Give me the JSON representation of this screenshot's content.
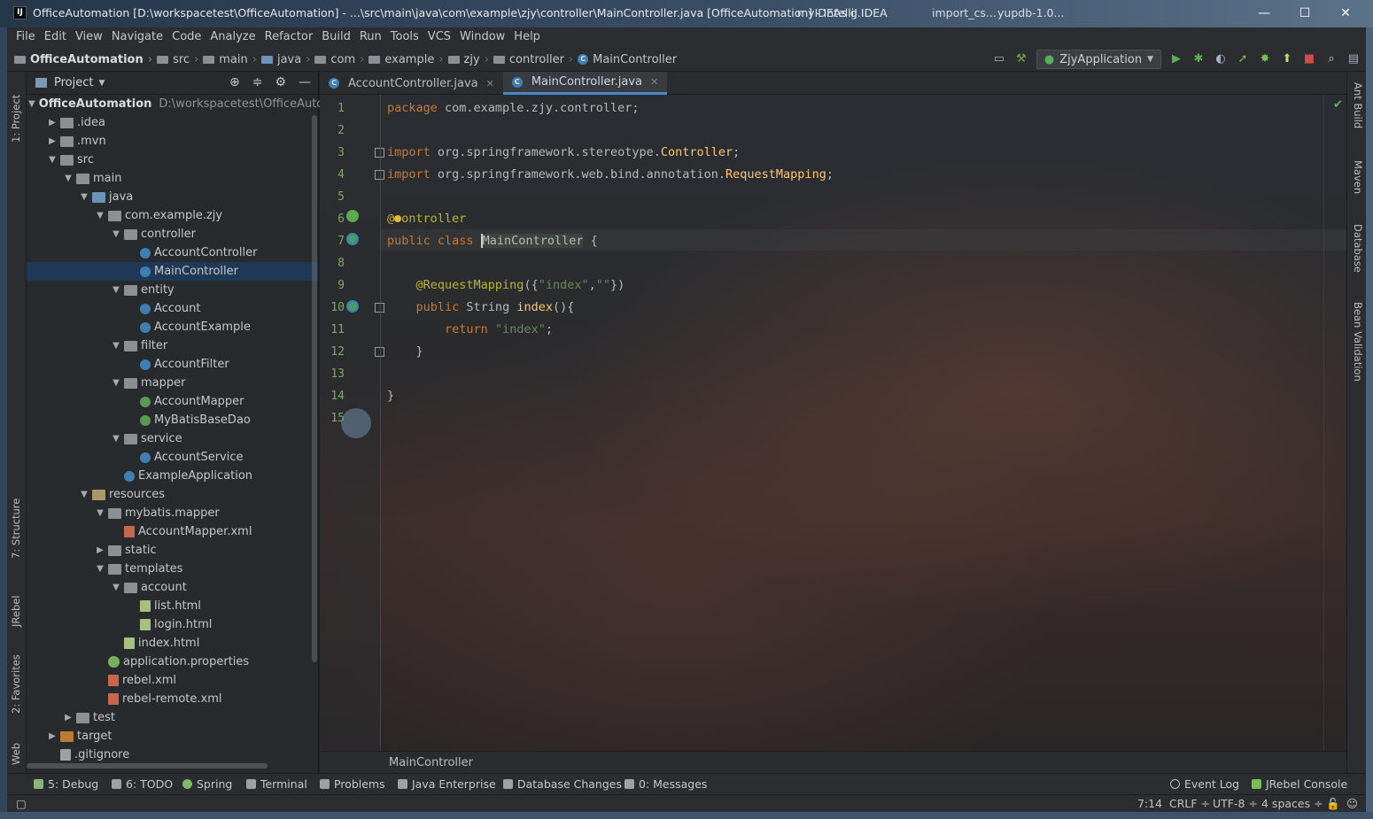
{
  "window": {
    "title": "OfficeAutomation [D:\\workspacetest\\OfficeAutomation] - ...\\src\\main\\java\\com\\example\\zjy\\controller\\MainController.java [OfficeAutomation] - IntelliJ IDEA",
    "ghost_1": "myIDEAs g...",
    "ghost_2": "import_cs...",
    "ghost_3": "yupdb-1.0...",
    "min": "—",
    "max": "☐",
    "close": "✕"
  },
  "menu": [
    "File",
    "Edit",
    "View",
    "Navigate",
    "Code",
    "Analyze",
    "Refactor",
    "Build",
    "Run",
    "Tools",
    "VCS",
    "Window",
    "Help"
  ],
  "nav": {
    "crumbs": [
      "OfficeAutomation",
      "src",
      "main",
      "java",
      "com",
      "example",
      "zjy",
      "controller",
      "MainController"
    ],
    "run_config": "ZjyApplication"
  },
  "left_tabs": {
    "project": "1: Project",
    "structure": "7: Structure",
    "jrebel": "JRebel",
    "favorites": "2: Favorites",
    "web": "Web"
  },
  "right_tabs": {
    "ant": "Ant Build",
    "maven": "Maven",
    "database": "Database",
    "bean": "Bean Validation"
  },
  "project": {
    "title": "Project",
    "tree": [
      {
        "depth": 0,
        "open": true,
        "icon": "src",
        "label": "OfficeAutomation",
        "extra": "D:\\workspacetest\\OfficeAutom",
        "bold": true
      },
      {
        "depth": 1,
        "open": false,
        "icon": "folder",
        "label": ".idea"
      },
      {
        "depth": 1,
        "open": false,
        "icon": "folder",
        "label": ".mvn"
      },
      {
        "depth": 1,
        "open": true,
        "icon": "folder",
        "label": "src"
      },
      {
        "depth": 2,
        "open": true,
        "icon": "folder",
        "label": "main"
      },
      {
        "depth": 3,
        "open": true,
        "icon": "src",
        "label": "java"
      },
      {
        "depth": 4,
        "open": true,
        "icon": "pkg",
        "label": "com.example.zjy"
      },
      {
        "depth": 5,
        "open": true,
        "icon": "pkg",
        "label": "controller"
      },
      {
        "depth": 6,
        "leaf": true,
        "icon": "cls",
        "label": "AccountController"
      },
      {
        "depth": 6,
        "leaf": true,
        "icon": "cls",
        "label": "MainController",
        "selected": true
      },
      {
        "depth": 5,
        "open": true,
        "icon": "pkg",
        "label": "entity"
      },
      {
        "depth": 6,
        "leaf": true,
        "icon": "cls",
        "label": "Account"
      },
      {
        "depth": 6,
        "leaf": true,
        "icon": "cls",
        "label": "AccountExample"
      },
      {
        "depth": 5,
        "open": true,
        "icon": "pkg",
        "label": "filter"
      },
      {
        "depth": 6,
        "leaf": true,
        "icon": "cls",
        "label": "AccountFilter"
      },
      {
        "depth": 5,
        "open": true,
        "icon": "pkg",
        "label": "mapper"
      },
      {
        "depth": 6,
        "leaf": true,
        "icon": "iface",
        "label": "AccountMapper"
      },
      {
        "depth": 6,
        "leaf": true,
        "icon": "iface",
        "label": "MyBatisBaseDao"
      },
      {
        "depth": 5,
        "open": true,
        "icon": "pkg",
        "label": "service"
      },
      {
        "depth": 6,
        "leaf": true,
        "icon": "cls",
        "label": "AccountService"
      },
      {
        "depth": 5,
        "leaf": true,
        "icon": "cls",
        "label": "ExampleApplication"
      },
      {
        "depth": 3,
        "open": true,
        "icon": "res",
        "label": "resources"
      },
      {
        "depth": 4,
        "open": true,
        "icon": "pkg",
        "label": "mybatis.mapper"
      },
      {
        "depth": 5,
        "leaf": true,
        "icon": "xml",
        "label": "AccountMapper.xml"
      },
      {
        "depth": 4,
        "open": false,
        "icon": "folder",
        "label": "static"
      },
      {
        "depth": 4,
        "open": true,
        "icon": "folder",
        "label": "templates"
      },
      {
        "depth": 5,
        "open": true,
        "icon": "folder",
        "label": "account"
      },
      {
        "depth": 6,
        "leaf": true,
        "icon": "html",
        "label": "list.html"
      },
      {
        "depth": 6,
        "leaf": true,
        "icon": "html",
        "label": "login.html"
      },
      {
        "depth": 5,
        "leaf": true,
        "icon": "html",
        "label": "index.html"
      },
      {
        "depth": 4,
        "leaf": true,
        "icon": "props",
        "label": "application.properties"
      },
      {
        "depth": 4,
        "leaf": true,
        "icon": "xml",
        "label": "rebel.xml"
      },
      {
        "depth": 4,
        "leaf": true,
        "icon": "xml",
        "label": "rebel-remote.xml"
      },
      {
        "depth": 2,
        "open": false,
        "icon": "folder",
        "label": "test"
      },
      {
        "depth": 1,
        "open": false,
        "icon": "target",
        "label": "target"
      },
      {
        "depth": 1,
        "leaf": true,
        "icon": "git",
        "label": ".gitignore"
      }
    ]
  },
  "editor": {
    "tabs": [
      {
        "label": "AccountController.java",
        "active": false
      },
      {
        "label": "MainController.java",
        "active": true
      }
    ],
    "line_numbers": [
      "1",
      "2",
      "3",
      "4",
      "5",
      "6",
      "7",
      "8",
      "9",
      "10",
      "11",
      "12",
      "13",
      "14",
      "15"
    ],
    "bottom_breadcrumb": "MainController"
  },
  "toolwindows": {
    "debug": "5: Debug",
    "todo": "6: TODO",
    "spring": "Spring",
    "terminal": "Terminal",
    "problems": "Problems",
    "java_enterprise": "Java Enterprise",
    "db_changes": "Database Changes",
    "messages": "0: Messages",
    "event_log": "Event Log",
    "jrebel_console": "JRebel Console"
  },
  "status": {
    "position": "7:14",
    "line_sep": "CRLF ÷",
    "encoding": "UTF-8 ÷",
    "indent": "4 spaces ÷"
  },
  "colors": {
    "keyword": "#cc7832",
    "annotation": "#bbb529",
    "string": "#6a8759",
    "method": "#ffc66d",
    "line_number": "#7ea868",
    "selection": "#203a58"
  }
}
